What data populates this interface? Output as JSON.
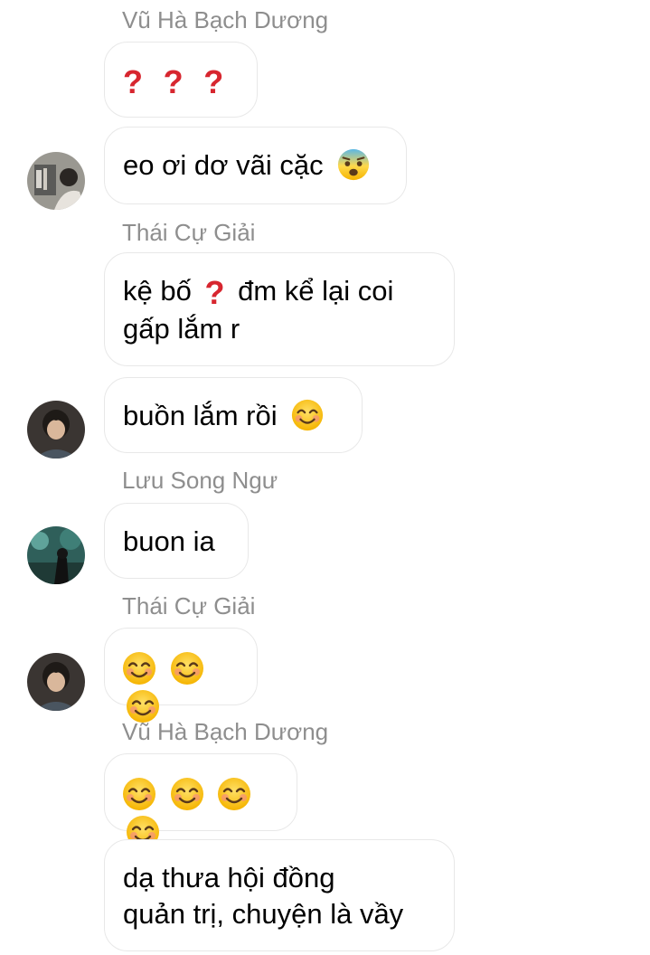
{
  "messages": [
    {
      "sender": "Vũ Hà Bạch Dương"
    },
    {
      "text_end": "eo ơi dơ vãi cặc",
      "emoji": "anxious-face-emoji"
    },
    {
      "sender": "Thái Cự Giải",
      "line1_a": "kệ bố",
      "line1_b": "đm kể lại coi",
      "line2": "gấp lắm r",
      "emoji": "question-mark-emoji"
    },
    {
      "text": "buồn lắm rồi",
      "emoji": "smiling-face-emoji"
    },
    {
      "sender": "Lưu Song Ngư",
      "text": "buon ia"
    },
    {
      "sender": "Thái Cự Giải",
      "emoji": "smiling-face-emoji x3"
    },
    {
      "sender": "Vũ Hà Bạch Dương",
      "emoji": "smiling-face-emoji x4"
    },
    {
      "line1": "dạ thưa hội đồng",
      "line2": "quản trị, chuyện là vầy"
    }
  ],
  "colors": {
    "sender_name": "#8e8e8e",
    "bubble_border": "#e8e8e8",
    "question_mark": "#d7262f"
  }
}
